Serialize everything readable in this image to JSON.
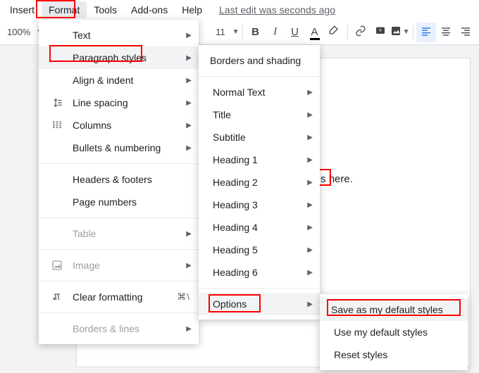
{
  "menubar": {
    "items": [
      "Insert",
      "Format",
      "Tools",
      "Add-ons",
      "Help"
    ],
    "active_index": 1,
    "last_edit": "Last edit was seconds ago"
  },
  "toolbar": {
    "zoom": "100%",
    "font_size": "11"
  },
  "format_menu": {
    "items": [
      {
        "label": "Text",
        "icon": "",
        "arrow": true
      },
      {
        "label": "Paragraph styles",
        "icon": "",
        "arrow": true,
        "hover": true
      },
      {
        "label": "Align & indent",
        "icon": "",
        "arrow": true
      },
      {
        "label": "Line spacing",
        "icon": "line-spacing",
        "arrow": true
      },
      {
        "label": "Columns",
        "icon": "columns",
        "arrow": true
      },
      {
        "label": "Bullets & numbering",
        "icon": "",
        "arrow": true
      },
      {
        "divider": true
      },
      {
        "label": "Headers & footers",
        "icon": "",
        "arrow": false
      },
      {
        "label": "Page numbers",
        "icon": "",
        "arrow": false
      },
      {
        "divider": true
      },
      {
        "label": "Table",
        "icon": "",
        "arrow": true,
        "disabled": true
      },
      {
        "divider": true
      },
      {
        "label": "Image",
        "icon": "image",
        "arrow": true,
        "disabled": true
      },
      {
        "divider": true
      },
      {
        "label": "Clear formatting",
        "icon": "clear",
        "shortcut": "⌘\\"
      },
      {
        "divider": true
      },
      {
        "label": "Borders & lines",
        "icon": "",
        "arrow": true,
        "disabled": true
      }
    ]
  },
  "paragraph_menu": {
    "items": [
      {
        "label": "Borders and shading"
      },
      {
        "divider": true
      },
      {
        "label": "Normal Text",
        "arrow": true
      },
      {
        "label": "Title",
        "arrow": true
      },
      {
        "label": "Subtitle",
        "arrow": true
      },
      {
        "label": "Heading 1",
        "arrow": true
      },
      {
        "label": "Heading 2",
        "arrow": true
      },
      {
        "label": "Heading 3",
        "arrow": true
      },
      {
        "label": "Heading 4",
        "arrow": true
      },
      {
        "label": "Heading 5",
        "arrow": true
      },
      {
        "label": "Heading 6",
        "arrow": true
      },
      {
        "divider": true
      },
      {
        "label": "Options",
        "arrow": true,
        "hover": true
      }
    ]
  },
  "options_menu": {
    "items": [
      {
        "label": "Save as my default styles",
        "hover": true
      },
      {
        "label": "Use my default styles"
      },
      {
        "label": "Reset styles"
      }
    ]
  },
  "document": {
    "body_text_suffix": " goes here."
  }
}
